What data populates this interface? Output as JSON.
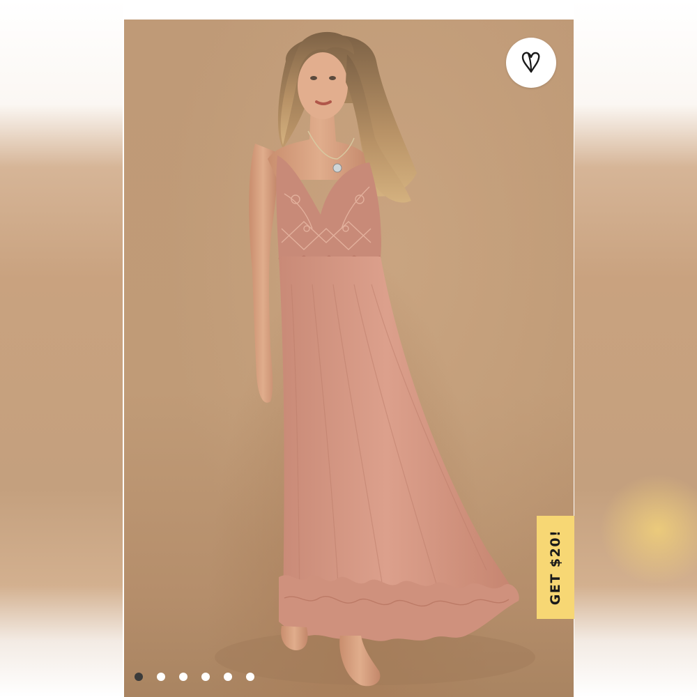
{
  "icons": {
    "favorite": "heart-icon"
  },
  "promo": {
    "label": "GET $20!",
    "color": "#f7d774"
  },
  "carousel": {
    "total_images": 6,
    "active_index": 0
  },
  "colors": {
    "photo_background": "#c09b77",
    "dress": "#d79a86",
    "active_dot": "#3b3b3b",
    "inactive_dot": "#ffffff"
  }
}
